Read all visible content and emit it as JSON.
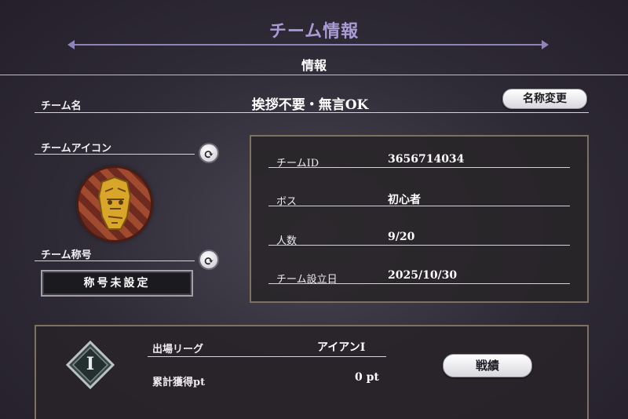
{
  "header": {
    "title": "チーム情報",
    "section": "情報"
  },
  "team_name": {
    "label": "チーム名",
    "value": "挨拶不要・無言OK",
    "rename_button": "名称変更"
  },
  "team_icon": {
    "label": "チームアイコン"
  },
  "team_title": {
    "label": "チーム称号",
    "value": "称号未設定"
  },
  "info": {
    "rows": [
      {
        "label": "チームID",
        "value": "3656714034"
      },
      {
        "label": "ボス",
        "value": "初心者"
      },
      {
        "label": "人数",
        "value": "9/20"
      },
      {
        "label": "チーム設立日",
        "value": "2025/10/30"
      }
    ]
  },
  "league": {
    "badge": "I",
    "label": "出場リーグ",
    "value": "アイアンⅠ",
    "points_label": "累計獲得pt",
    "points_value": "0 pt",
    "record_button": "戦績"
  }
}
